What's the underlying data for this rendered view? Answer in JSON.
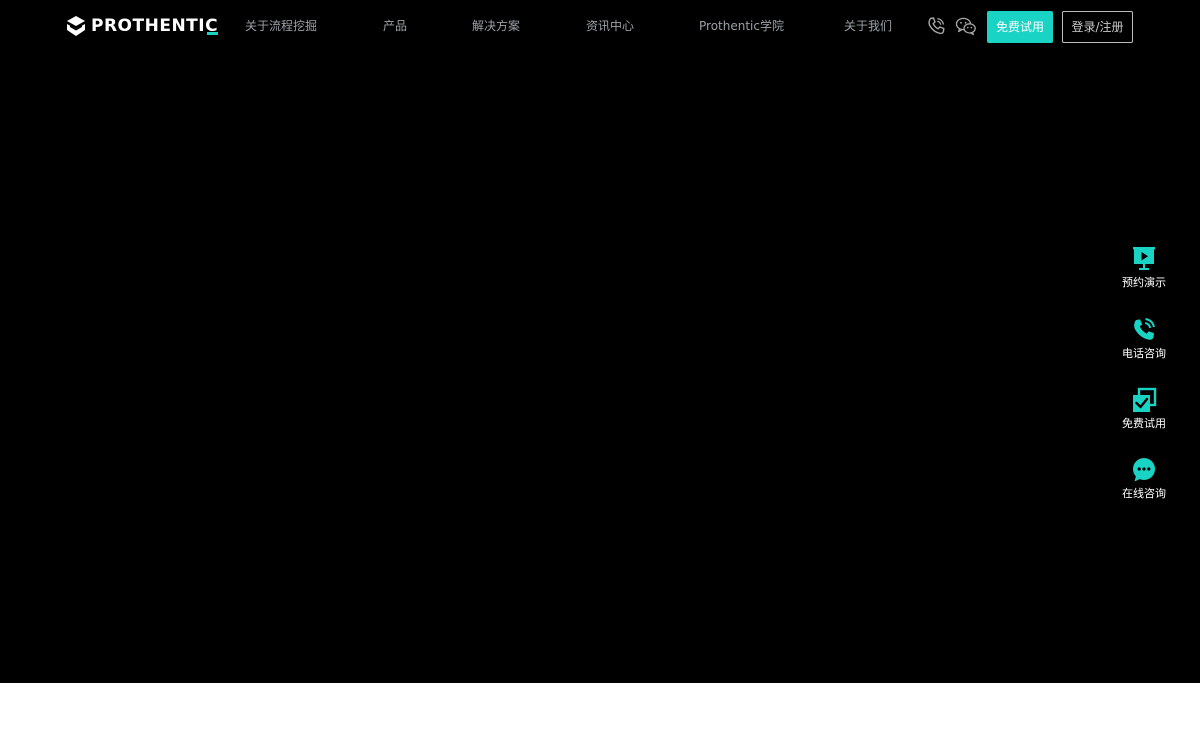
{
  "brand": {
    "name": "PROTHENTIC",
    "accent_color": "#19d3c5"
  },
  "nav": {
    "items": [
      {
        "label": "关于流程挖掘"
      },
      {
        "label": "产品"
      },
      {
        "label": "解决方案"
      },
      {
        "label": "资讯中心"
      },
      {
        "label": "Prothentic学院"
      },
      {
        "label": "关于我们"
      }
    ]
  },
  "header": {
    "icons": [
      "phone-icon",
      "wechat-icon"
    ],
    "trial_button": "免费试用",
    "login_button": "登录/注册"
  },
  "side_menu": {
    "items": [
      {
        "label": "预约演示",
        "icon": "presentation-play-icon"
      },
      {
        "label": "电话咨询",
        "icon": "phone-icon"
      },
      {
        "label": "免费试用",
        "icon": "trial-check-icon"
      },
      {
        "label": "在线咨询",
        "icon": "chat-bubble-icon"
      }
    ]
  },
  "colors": {
    "hero_background": "#000000",
    "page_background": "#ffffff",
    "nav_text": "#9aa0a6"
  }
}
